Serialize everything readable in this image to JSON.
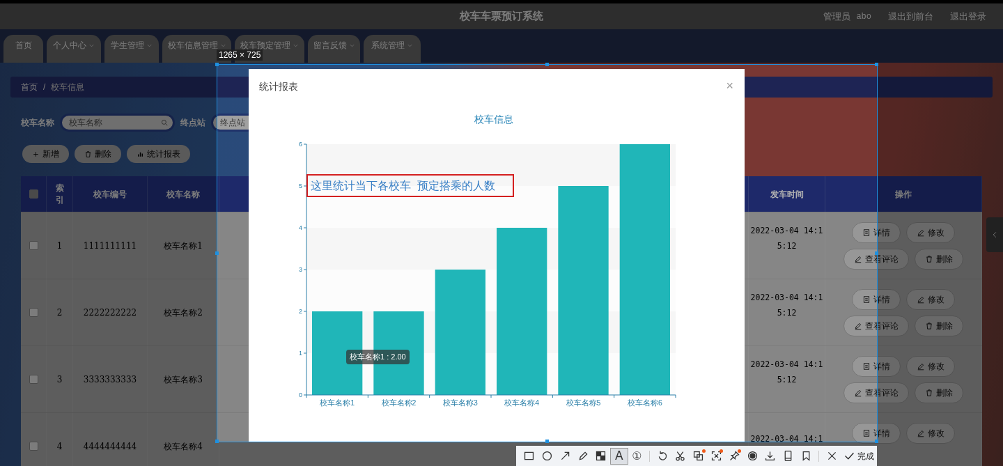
{
  "header": {
    "title": "校车车票预订系统",
    "role": "管理员",
    "username": "abo",
    "links": [
      "退出到前台",
      "退出登录"
    ]
  },
  "nav": [
    {
      "label": "首页",
      "dropdown": false
    },
    {
      "label": "个人中心",
      "dropdown": true
    },
    {
      "label": "学生管理",
      "dropdown": true
    },
    {
      "label": "校车信息管理",
      "dropdown": true
    },
    {
      "label": "校车预定管理",
      "dropdown": true
    },
    {
      "label": "留言反馈",
      "dropdown": true
    },
    {
      "label": "系统管理",
      "dropdown": true
    }
  ],
  "breadcrumb": [
    "首页",
    "校车信息"
  ],
  "breadcrumb_separator": "/",
  "search": [
    {
      "kind": "search",
      "label": "校车名称",
      "placeholder": "校车名称"
    },
    {
      "kind": "plain",
      "label": "终点站",
      "placeholder": "终点站"
    }
  ],
  "actions": [
    {
      "kind": "add",
      "label": "新增"
    },
    {
      "kind": "delete",
      "label": "删除"
    },
    {
      "kind": "report",
      "label": "统计报表"
    }
  ],
  "table": {
    "select_all": {
      "checked": false
    },
    "columns": [
      "索引",
      "校车编号",
      "校车名称",
      "发车时间",
      "操作"
    ],
    "rows": [
      {
        "checked": false,
        "index": "1",
        "number": "1111111111",
        "name": "校车名称1",
        "departure": "2022-03-04 14:15:12",
        "actions": [
          {
            "kind": "detail",
            "label": "详情"
          },
          {
            "kind": "edit",
            "label": "修改"
          },
          {
            "kind": "comments",
            "label": "查看评论"
          },
          {
            "kind": "delete",
            "label": "删除"
          }
        ]
      },
      {
        "checked": false,
        "index": "2",
        "number": "2222222222",
        "name": "校车名称2",
        "departure": "2022-03-04 14:15:12",
        "actions": [
          {
            "kind": "detail",
            "label": "详情"
          },
          {
            "kind": "edit",
            "label": "修改"
          },
          {
            "kind": "comments",
            "label": "查看评论"
          },
          {
            "kind": "delete",
            "label": "删除"
          }
        ]
      },
      {
        "checked": false,
        "index": "3",
        "number": "3333333333",
        "name": "校车名称3",
        "departure": "2022-03-04 14:15:12",
        "actions": [
          {
            "kind": "detail",
            "label": "详情"
          },
          {
            "kind": "edit",
            "label": "修改"
          },
          {
            "kind": "comments",
            "label": "查看评论"
          },
          {
            "kind": "delete",
            "label": "删除"
          }
        ]
      },
      {
        "checked": false,
        "index": "4",
        "number": "4444444444",
        "name": "校车名称4",
        "departure": "2022-03-04 14:1",
        "actions": [
          {
            "kind": "detail",
            "label": "详情"
          },
          {
            "kind": "edit",
            "label": "修改"
          }
        ]
      }
    ]
  },
  "modal": {
    "title": "统计报表",
    "close": "×",
    "tooltip": "校车名称1 : 2.00",
    "chart_data": {
      "type": "bar",
      "title": "校车信息",
      "categories": [
        "校车名称1",
        "校车名称2",
        "校车名称3",
        "校车名称4",
        "校车名称5",
        "校车名称6"
      ],
      "series": [
        {
          "color": "#20b6b8",
          "values": [
            2,
            2,
            3,
            4,
            5,
            6
          ]
        }
      ],
      "ylim": [
        0,
        6
      ],
      "yticks": [
        0,
        1,
        2,
        3,
        4,
        5,
        6
      ]
    }
  },
  "annotation": {
    "text": "这里统计当下各校车  预定搭乘的人数"
  },
  "capture": {
    "size_label": "1265 × 725",
    "tool_groups": [
      [
        {
          "kind": "rectangle",
          "selected": false
        },
        {
          "kind": "ellipse",
          "selected": false
        },
        {
          "kind": "arrow",
          "selected": false
        },
        {
          "kind": "pencil",
          "selected": false
        },
        {
          "kind": "mosaic",
          "selected": false
        },
        {
          "kind": "text",
          "glyph": "A",
          "selected": true
        },
        {
          "kind": "number",
          "glyph": "①",
          "selected": false
        }
      ],
      [
        {
          "kind": "undo",
          "badge": false
        },
        {
          "kind": "scissors",
          "badge": false
        },
        {
          "kind": "translate",
          "badge": true
        },
        {
          "kind": "scan",
          "badge": true
        },
        {
          "kind": "pin",
          "badge": true
        },
        {
          "kind": "record",
          "badge": false
        },
        {
          "kind": "download",
          "badge": false
        },
        {
          "kind": "phone",
          "badge": false
        },
        {
          "kind": "bookmark",
          "badge": false
        }
      ],
      [
        {
          "kind": "cancel"
        },
        {
          "kind": "confirm",
          "label": "完成"
        }
      ]
    ]
  }
}
